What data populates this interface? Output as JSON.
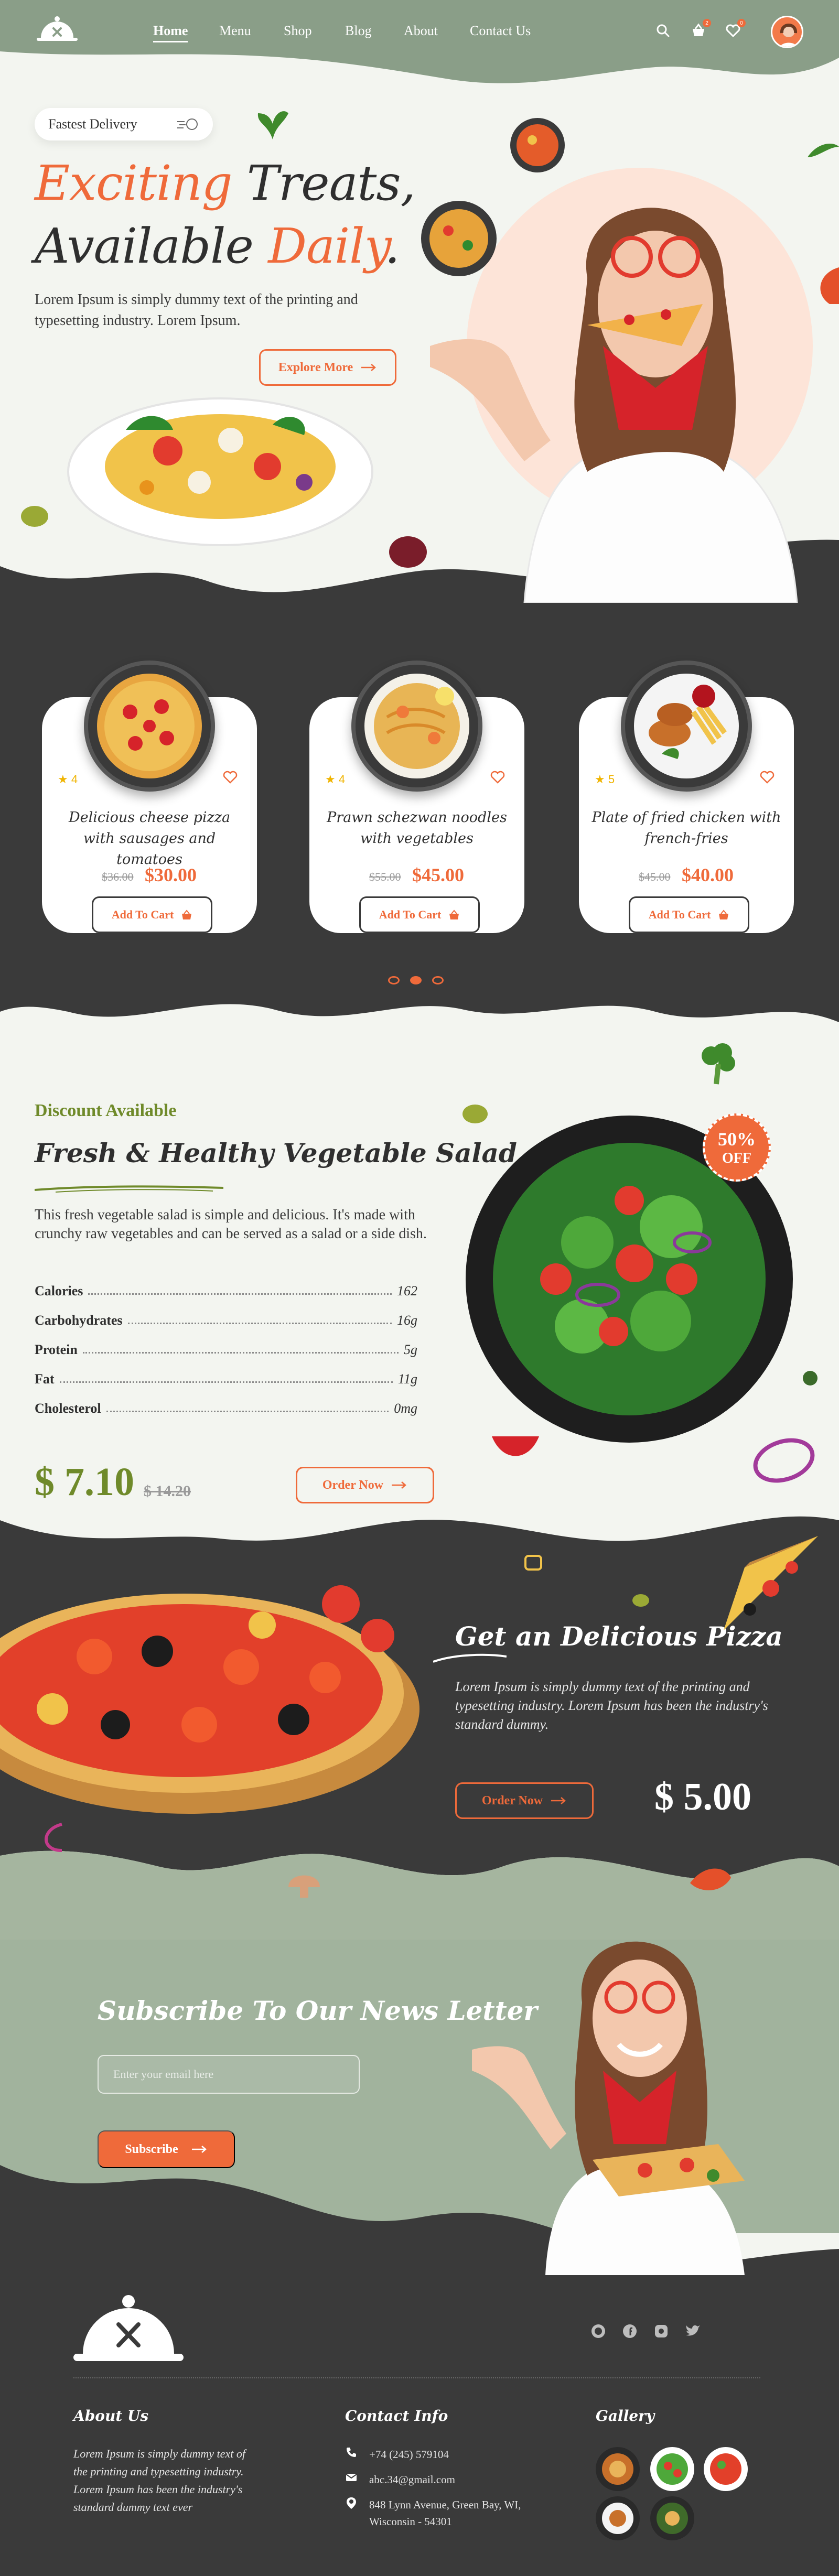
{
  "colors": {
    "accent": "#ef6a3a",
    "dark": "#3a3a3a",
    "sage": "#8a9e88",
    "cream": "#f3f5f0",
    "star": "#f0b400"
  },
  "header": {
    "nav": [
      "Home",
      "Menu",
      "Shop",
      "Blog",
      "About",
      "Contact Us"
    ],
    "cart_count": "2",
    "wishlist_count": "0"
  },
  "hero": {
    "badge": "Fastest Delivery",
    "title_line1_orange": "Exciting",
    "title_line1_dark": " Treats,",
    "title_line2_dark": "Available ",
    "title_line2_orange": "Daily",
    "title_line2_period": ".",
    "description": "Lorem Ipsum is simply dummy text of the printing and typesetting industry. Lorem Ipsum.",
    "cta": "Explore More"
  },
  "products": [
    {
      "name": "Delicious cheese pizza with sausages and tomatoes",
      "rating": "4",
      "old_price": "$36.00",
      "price": "$30.00",
      "cta": "Add To Cart"
    },
    {
      "name": "Prawn schezwan noodles with vegetables",
      "rating": "4",
      "old_price": "$55.00",
      "price": "$45.00",
      "cta": "Add To Cart"
    },
    {
      "name": "Plate of fried chicken with french-fries",
      "rating": "5",
      "old_price": "$45.00",
      "price": "$40.00",
      "cta": "Add To Cart"
    }
  ],
  "carousel": {
    "pages": 3,
    "active": 2
  },
  "salad": {
    "kicker": "Discount Available",
    "title": "Fresh & Healthy Vegetable Salad",
    "description": "This fresh vegetable salad is simple and delicious. It's made with crunchy raw vegetables and can be served as a salad or a side dish.",
    "nutrition": [
      {
        "label": "Calories",
        "value": "162"
      },
      {
        "label": "Carbohydrates",
        "value": "16g"
      },
      {
        "label": "Protein",
        "value": "5g"
      },
      {
        "label": "Fat",
        "value": "11g"
      },
      {
        "label": "Cholesterol",
        "value": "0mg"
      }
    ],
    "price": "$ 7.10",
    "old_price": "$ 14.20",
    "cta": "Order Now",
    "discount_value": "50%",
    "discount_label": "OFF"
  },
  "pizza": {
    "title": "Get an Delicious Pizza",
    "description": "Lorem Ipsum is simply dummy text of the printing and typesetting industry. Lorem Ipsum has been the industry's standard dummy.",
    "cta": "Order Now",
    "price": "$ 5.00"
  },
  "newsletter": {
    "title": "Subscribe To Our News Letter",
    "placeholder": "Enter your email here",
    "cta": "Subscribe"
  },
  "footer": {
    "about_title": "About Us",
    "about_text": "Lorem Ipsum is simply dummy text of the printing and typesetting industry. Lorem Ipsum has been the industry's standard dummy text ever",
    "contact_title": "Contact Info",
    "phone": "+74 (245) 579104",
    "email": "abc.34@gmail.com",
    "address": "848 Lynn Avenue, Green Bay, WI, Wisconsin - 54301",
    "gallery_title": "Gallery",
    "social": [
      "whatsapp-icon",
      "facebook-icon",
      "instagram-icon",
      "twitter-icon"
    ]
  }
}
